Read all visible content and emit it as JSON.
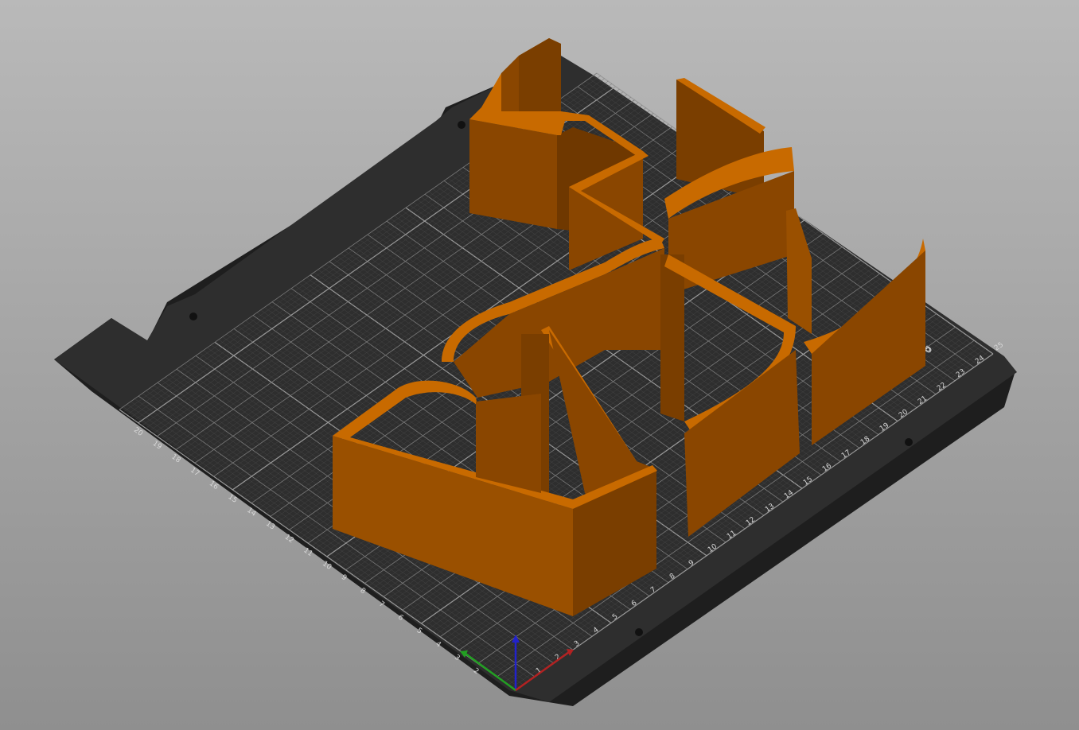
{
  "viewport": {
    "name": "3D build plate preview",
    "bed_color": "#2b2b2b",
    "grid_color": "#6a6a6a",
    "model_color": "#c86a00",
    "model_side_color": "#8a4600",
    "axis_colors": {
      "x": "#b22222",
      "y": "#22a022",
      "z": "#2222cc"
    }
  },
  "bed": {
    "logo_text": "P",
    "x_ticks": [
      "1",
      "2",
      "3",
      "4",
      "5",
      "6",
      "7",
      "8",
      "9",
      "10",
      "11",
      "12",
      "13",
      "14",
      "15",
      "16",
      "17",
      "18",
      "19",
      "20",
      "21",
      "22",
      "23",
      "24",
      "25"
    ],
    "y_ticks": [
      "2",
      "3",
      "4",
      "5",
      "6",
      "7",
      "8",
      "9",
      "10",
      "11",
      "12",
      "13",
      "14",
      "15",
      "16",
      "17",
      "18",
      "19",
      "20"
    ]
  },
  "model": {
    "description_icon": "cookie-cutter-model",
    "parts": [
      "part-1",
      "part-2",
      "part-3",
      "part-4",
      "part-5",
      "part-6"
    ]
  }
}
